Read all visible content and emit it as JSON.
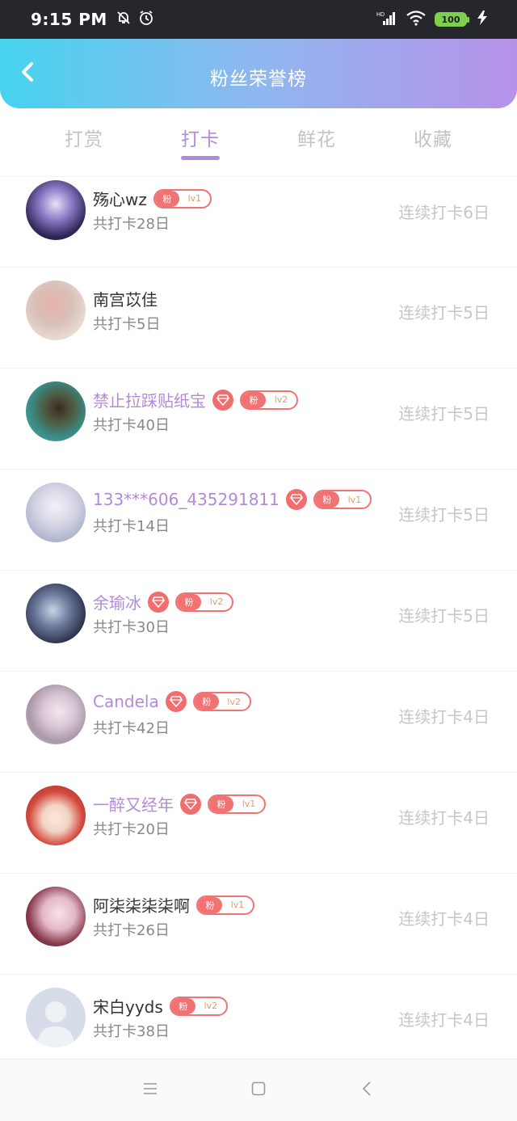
{
  "status_bar": {
    "time": "9:15 PM",
    "battery": "100",
    "icons": [
      "mute-icon",
      "alarm-icon",
      "signal-icon",
      "wifi-icon",
      "battery-icon",
      "charging-icon"
    ]
  },
  "header": {
    "title": "粉丝荣誉榜",
    "back_icon": "chevron-left-icon"
  },
  "tabs": [
    {
      "label": "打赏",
      "active": false
    },
    {
      "label": "打卡",
      "active": true
    },
    {
      "label": "鲜花",
      "active": false
    },
    {
      "label": "收藏",
      "active": false
    }
  ],
  "colors": {
    "accent": "#b58ad8",
    "badge_red": "#f07272",
    "header_gradient": [
      "#46d3ef",
      "#b792ea"
    ]
  },
  "rows": [
    {
      "name": "殇心wz",
      "vip": false,
      "diamond": false,
      "level": "lv1",
      "fan": "粉",
      "total": "共打卡28日",
      "streak": "连续打卡6日"
    },
    {
      "name": "南宫苡佳",
      "vip": false,
      "diamond": false,
      "level": "",
      "fan": "",
      "total": "共打卡5日",
      "streak": "连续打卡5日"
    },
    {
      "name": "禁止拉踩贴纸宝",
      "vip": true,
      "diamond": true,
      "level": "lv2",
      "fan": "粉",
      "total": "共打卡40日",
      "streak": "连续打卡5日"
    },
    {
      "name": "133***606_435291811",
      "vip": true,
      "diamond": true,
      "level": "lv1",
      "fan": "粉",
      "total": "共打卡14日",
      "streak": "连续打卡5日"
    },
    {
      "name": "余瑜冰",
      "vip": true,
      "diamond": true,
      "level": "lv2",
      "fan": "粉",
      "total": "共打卡30日",
      "streak": "连续打卡5日"
    },
    {
      "name": "Candela",
      "vip": true,
      "diamond": true,
      "level": "lv2",
      "fan": "粉",
      "total": "共打卡42日",
      "streak": "连续打卡4日"
    },
    {
      "name": "一醉又经年",
      "vip": true,
      "diamond": true,
      "level": "lv1",
      "fan": "粉",
      "total": "共打卡20日",
      "streak": "连续打卡4日"
    },
    {
      "name": "阿柒柒柒柒啊",
      "vip": false,
      "diamond": false,
      "level": "lv1",
      "fan": "粉",
      "total": "共打卡26日",
      "streak": "连续打卡4日"
    },
    {
      "name": "宋白yyds",
      "vip": false,
      "diamond": false,
      "level": "lv2",
      "fan": "粉",
      "total": "共打卡38日",
      "streak": "连续打卡4日"
    }
  ],
  "nav_bar": {
    "icons": [
      "menu-icon",
      "home-icon",
      "back-icon"
    ]
  }
}
